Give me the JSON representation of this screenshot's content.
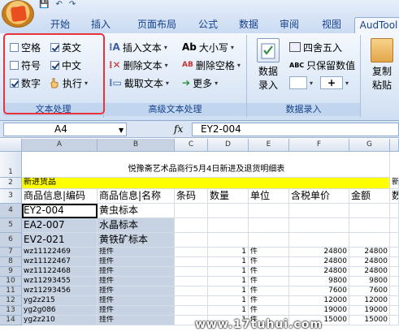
{
  "tabs": [
    "开始",
    "插入",
    "页面布局",
    "公式",
    "数据",
    "审阅",
    "视图",
    "AudTool"
  ],
  "quick_access": [
    "💾",
    "↶",
    "↷"
  ],
  "ribbon": {
    "text_processing": {
      "label": "文本处理",
      "items": [
        {
          "label": "空格",
          "checked": false
        },
        {
          "label": "英文",
          "checked": true
        },
        {
          "label": "符号",
          "checked": false
        },
        {
          "label": "中文",
          "checked": true
        },
        {
          "label": "数字",
          "checked": true
        },
        {
          "label": "执行",
          "checked": null
        }
      ]
    },
    "advanced_text": {
      "label": "高级文本处理",
      "items": [
        "插入文本",
        "删除文本",
        "截取文本",
        "大小写",
        "删除空格",
        "更多"
      ]
    },
    "data_entry": {
      "label": "数据录入",
      "big_label_1": "数据",
      "big_label_2": "录入",
      "items": [
        "四舍五入",
        "只保留数值"
      ]
    },
    "copy_paste": {
      "label_1": "复制",
      "label_2": "粘贴"
    }
  },
  "formula_bar": {
    "name_box": "A4",
    "fx": "fx",
    "content": "EY2-004"
  },
  "columns": [
    "A",
    "B",
    "C",
    "D",
    "E",
    "F",
    "G"
  ],
  "rows": [
    "1",
    "2",
    "3",
    "4",
    "5",
    "6",
    "7",
    "8",
    "9",
    "10",
    "11",
    "12",
    "13",
    "14"
  ],
  "sheet": {
    "title": "悦豫斋艺术品商行5月4日新进及退货明细表",
    "new_goods": "新进货品",
    "header": [
      "商品信息|编码",
      "商品信息|名称",
      "条码",
      "数量",
      "单位",
      "含税单价",
      "金额"
    ],
    "data": [
      [
        "EY2-004",
        "黄虫标本",
        "",
        "",
        "",
        "",
        ""
      ],
      [
        "EA2-007",
        "水晶标本",
        "",
        "",
        "",
        "",
        ""
      ],
      [
        "EV2-021",
        "黄铁矿标本",
        "",
        "",
        "",
        "",
        ""
      ],
      [
        "wz11122469",
        "挂件",
        "",
        "1",
        "件",
        "24800",
        "24800"
      ],
      [
        "wz11122467",
        "挂件",
        "",
        "1",
        "件",
        "24800",
        "24800"
      ],
      [
        "wz11122468",
        "挂件",
        "",
        "1",
        "件",
        "24800",
        "24800"
      ],
      [
        "wz11293455",
        "挂件",
        "",
        "1",
        "件",
        "9800",
        "9800"
      ],
      [
        "wz11293456",
        "挂件",
        "",
        "1",
        "件",
        "7600",
        "7600"
      ],
      [
        "yg2z215",
        "挂件",
        "",
        "1",
        "件",
        "12000",
        "12000"
      ],
      [
        "yg2g086",
        "挂件",
        "",
        "1",
        "件",
        "19000",
        "19000"
      ],
      [
        "yg2z210",
        "挂件",
        "",
        "1",
        "件",
        "15000",
        "15000"
      ]
    ],
    "overflow_h": "数",
    "overflow_h2": "新"
  },
  "watermark": "www.17tuhui.com"
}
